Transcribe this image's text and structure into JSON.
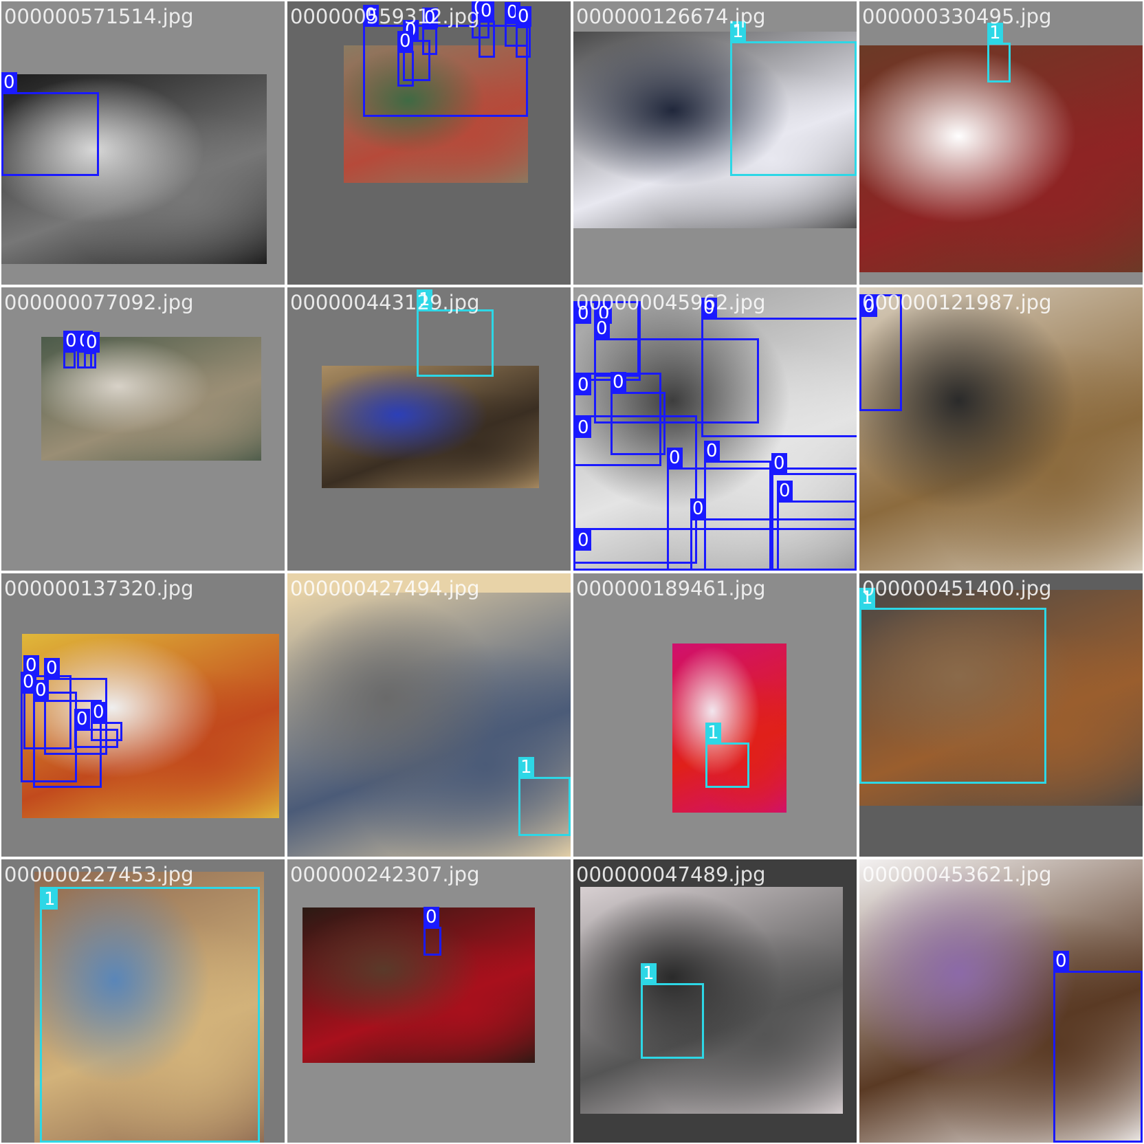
{
  "classes": {
    "0": {
      "label": "0",
      "color": "#1a1aff"
    },
    "1": {
      "label": "1",
      "color": "#2dd7e6"
    }
  },
  "tiles": [
    {
      "filename": "000000571514.jpg",
      "background": "#8c8c8c",
      "photo_colors": [
        "#1b1b1b",
        "#777777",
        "#d8d8d8"
      ],
      "boxes": [
        {
          "cls": "0",
          "label": "0"
        }
      ]
    },
    {
      "filename": "000000559312.jpg",
      "background": "#666666",
      "photo_colors": [
        "#8a7b62",
        "#b64a3a",
        "#3f6a44"
      ],
      "boxes": [
        {
          "cls": "0",
          "label": "0"
        },
        {
          "cls": "0",
          "label": "0"
        },
        {
          "cls": "0",
          "label": "0"
        },
        {
          "cls": "0",
          "label": "0"
        },
        {
          "cls": "0",
          "label": "0"
        },
        {
          "cls": "0",
          "label": "0"
        },
        {
          "cls": "0",
          "label": "0"
        },
        {
          "cls": "0",
          "label": "0"
        }
      ]
    },
    {
      "filename": "000000126674.jpg",
      "background": "#8e8e8e",
      "photo_colors": [
        "#4a4a4a",
        "#e8e8f0",
        "#20273b"
      ],
      "boxes": [
        {
          "cls": "1",
          "label": "1"
        }
      ]
    },
    {
      "filename": "000000330495.jpg",
      "background": "#8a8a8a",
      "photo_colors": [
        "#6b3a26",
        "#8e2424",
        "#ffffff"
      ],
      "boxes": [
        {
          "cls": "1",
          "label": "1"
        }
      ]
    },
    {
      "filename": "000000077092.jpg",
      "background": "#8c8c8c",
      "photo_colors": [
        "#4c5b4a",
        "#9a8e75",
        "#d8d2c8"
      ],
      "boxes": [
        {
          "cls": "0",
          "label": "0"
        },
        {
          "cls": "0",
          "label": "0"
        },
        {
          "cls": "0",
          "label": "0"
        }
      ]
    },
    {
      "filename": "000000443129.jpg",
      "background": "#787878",
      "photo_colors": [
        "#a98c62",
        "#3a2e22",
        "#2c3fb8"
      ],
      "boxes": [
        {
          "cls": "1",
          "label": "1"
        }
      ]
    },
    {
      "filename": "000000045962.jpg",
      "background": "#6e6e6e",
      "photo_colors": [
        "#9a9a9a",
        "#e4e4e4",
        "#3d3d3d"
      ],
      "boxes": [
        {
          "cls": "0",
          "label": "0"
        },
        {
          "cls": "0",
          "label": "0"
        },
        {
          "cls": "0",
          "label": "0"
        },
        {
          "cls": "0",
          "label": "0"
        },
        {
          "cls": "0",
          "label": "0"
        },
        {
          "cls": "0",
          "label": "0"
        },
        {
          "cls": "0",
          "label": "0"
        },
        {
          "cls": "0",
          "label": "0"
        },
        {
          "cls": "0",
          "label": "0"
        },
        {
          "cls": "0",
          "label": "0"
        },
        {
          "cls": "0",
          "label": "0"
        },
        {
          "cls": "0",
          "label": "0"
        },
        {
          "cls": "0",
          "label": "0"
        }
      ]
    },
    {
      "filename": "000000121987.jpg",
      "background": "#3c3c3c",
      "photo_colors": [
        "#d9cfbf",
        "#8c6b3e",
        "#2a2a2a"
      ],
      "boxes": [
        {
          "cls": "0",
          "label": "0"
        }
      ]
    },
    {
      "filename": "000000137320.jpg",
      "background": "#808080",
      "photo_colors": [
        "#e0b83a",
        "#c24a1d",
        "#efefef"
      ],
      "boxes": [
        {
          "cls": "0",
          "label": "0"
        },
        {
          "cls": "0",
          "label": "0"
        },
        {
          "cls": "0",
          "label": "0"
        },
        {
          "cls": "0",
          "label": "0"
        },
        {
          "cls": "0",
          "label": "0"
        },
        {
          "cls": "0",
          "label": "0"
        }
      ]
    },
    {
      "filename": "000000427494.jpg",
      "background": "#e8d3a8",
      "photo_colors": [
        "#e8d3a8",
        "#4b5b78",
        "#6a6a6a"
      ],
      "boxes": [
        {
          "cls": "1",
          "label": "1"
        }
      ]
    },
    {
      "filename": "000000189461.jpg",
      "background": "#8c8c8c",
      "photo_colors": [
        "#d0106e",
        "#e0201a",
        "#f2e6ee"
      ],
      "boxes": [
        {
          "cls": "1",
          "label": "1"
        }
      ]
    },
    {
      "filename": "000000451400.jpg",
      "background": "#5e5e5e",
      "photo_colors": [
        "#4b4846",
        "#9a5e2e",
        "#8a6a4a"
      ],
      "boxes": [
        {
          "cls": "1",
          "label": "1"
        }
      ]
    },
    {
      "filename": "000000227453.jpg",
      "background": "#7a7a7a",
      "photo_colors": [
        "#8e6a52",
        "#d2b27a",
        "#5a86b8"
      ],
      "boxes": [
        {
          "cls": "1",
          "label": "1"
        }
      ]
    },
    {
      "filename": "000000242307.jpg",
      "background": "#8e8e8e",
      "photo_colors": [
        "#2b1a14",
        "#a8101c",
        "#5a3a2a"
      ],
      "boxes": [
        {
          "cls": "0",
          "label": "0"
        }
      ]
    },
    {
      "filename": "000000047489.jpg",
      "background": "#3e3e3e",
      "photo_colors": [
        "#d8d0d2",
        "#555555",
        "#2a2a2a"
      ],
      "boxes": [
        {
          "cls": "1",
          "label": "1"
        }
      ]
    },
    {
      "filename": "000000453621.jpg",
      "background": "#b7b7bd",
      "photo_colors": [
        "#f4f2f2",
        "#5a3a24",
        "#8c6aa8"
      ],
      "boxes": [
        {
          "cls": "0",
          "label": "0"
        }
      ]
    }
  ]
}
